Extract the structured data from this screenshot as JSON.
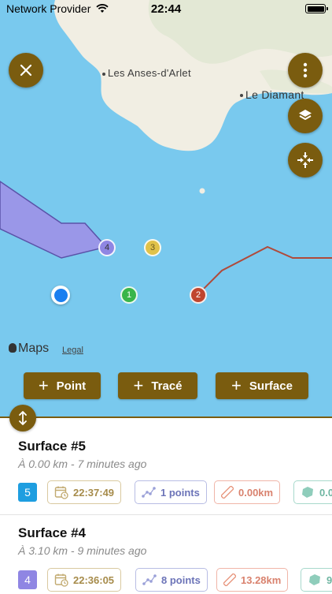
{
  "status_bar": {
    "carrier": "Network Provider",
    "time": "22:44"
  },
  "map": {
    "places": [
      {
        "name": "Les Anses-d'Arlet"
      },
      {
        "name": "Le Diamant"
      }
    ],
    "markers": [
      {
        "label": "4",
        "color": "#8f86e3"
      },
      {
        "label": "3",
        "color": "#e0c24a"
      },
      {
        "label": "1",
        "color": "#39b54a"
      },
      {
        "label": "2",
        "color": "#c0452e"
      }
    ],
    "attribution": "Maps",
    "legal": "Legal",
    "colors": {
      "water": "#79c9ee",
      "land": "#f2efe6",
      "surface_fill": "#9a97e8",
      "surface_stroke": "#5a52a8",
      "trace": "#b04a3a"
    }
  },
  "controls": {
    "close_icon": "close-icon",
    "more_icon": "ellipsis-vertical-icon",
    "layers_icon": "layers-icon",
    "recenter_icon": "arrows-inward-icon"
  },
  "add_buttons": [
    {
      "label": "Point"
    },
    {
      "label": "Tracé"
    },
    {
      "label": "Surface"
    }
  ],
  "list": [
    {
      "title": "Surface #5",
      "subtitle": "À 0.00 km - 7 minutes ago",
      "badge": "5",
      "badge_color": "#1e9ee0",
      "time": "22:37:49",
      "points": "1 points",
      "distance": "0.00km",
      "area": "0.0"
    },
    {
      "title": "Surface #4",
      "subtitle": "À 3.10 km - 9 minutes ago",
      "badge": "4",
      "badge_color": "#8f86e3",
      "time": "22:36:05",
      "points": "8 points",
      "distance": "13.28km",
      "area": "9"
    }
  ],
  "accent": "#7a5c0f"
}
